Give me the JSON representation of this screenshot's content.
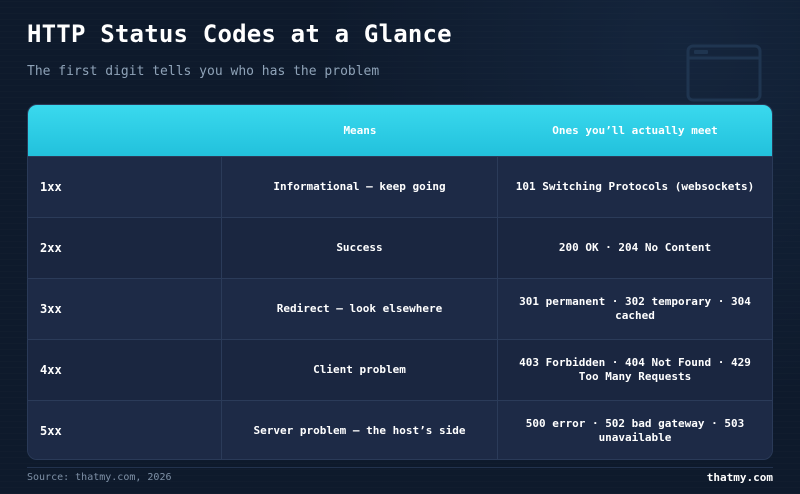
{
  "header": {
    "title": "HTTP Status Codes at a Glance",
    "subtitle": "The first digit tells you who has the problem"
  },
  "background_icon": "browser-window-icon",
  "table": {
    "columns": [
      "",
      "Means",
      "Ones you’ll actually meet"
    ],
    "rows": [
      {
        "code": "1xx",
        "means": "Informational — keep going",
        "examples": "101 Switching Protocols (websockets)"
      },
      {
        "code": "2xx",
        "means": "Success",
        "examples": "200 OK · 204 No Content"
      },
      {
        "code": "3xx",
        "means": "Redirect — look elsewhere",
        "examples": "301 permanent · 302 temporary · 304 cached"
      },
      {
        "code": "4xx",
        "means": "Client problem",
        "examples": "403 Forbidden · 404 Not Found · 429 Too Many Requests"
      },
      {
        "code": "5xx",
        "means": "Server problem — the host’s side",
        "examples": "500 error · 502 bad gateway · 503 unavailable"
      }
    ]
  },
  "footer": {
    "source": "Source: thatmy.com, 2026",
    "brand": "thatmy.com"
  },
  "colors": {
    "background": "#0e1a2c",
    "header_accent": "#2fd0e8",
    "table_body": "#1b2843"
  }
}
